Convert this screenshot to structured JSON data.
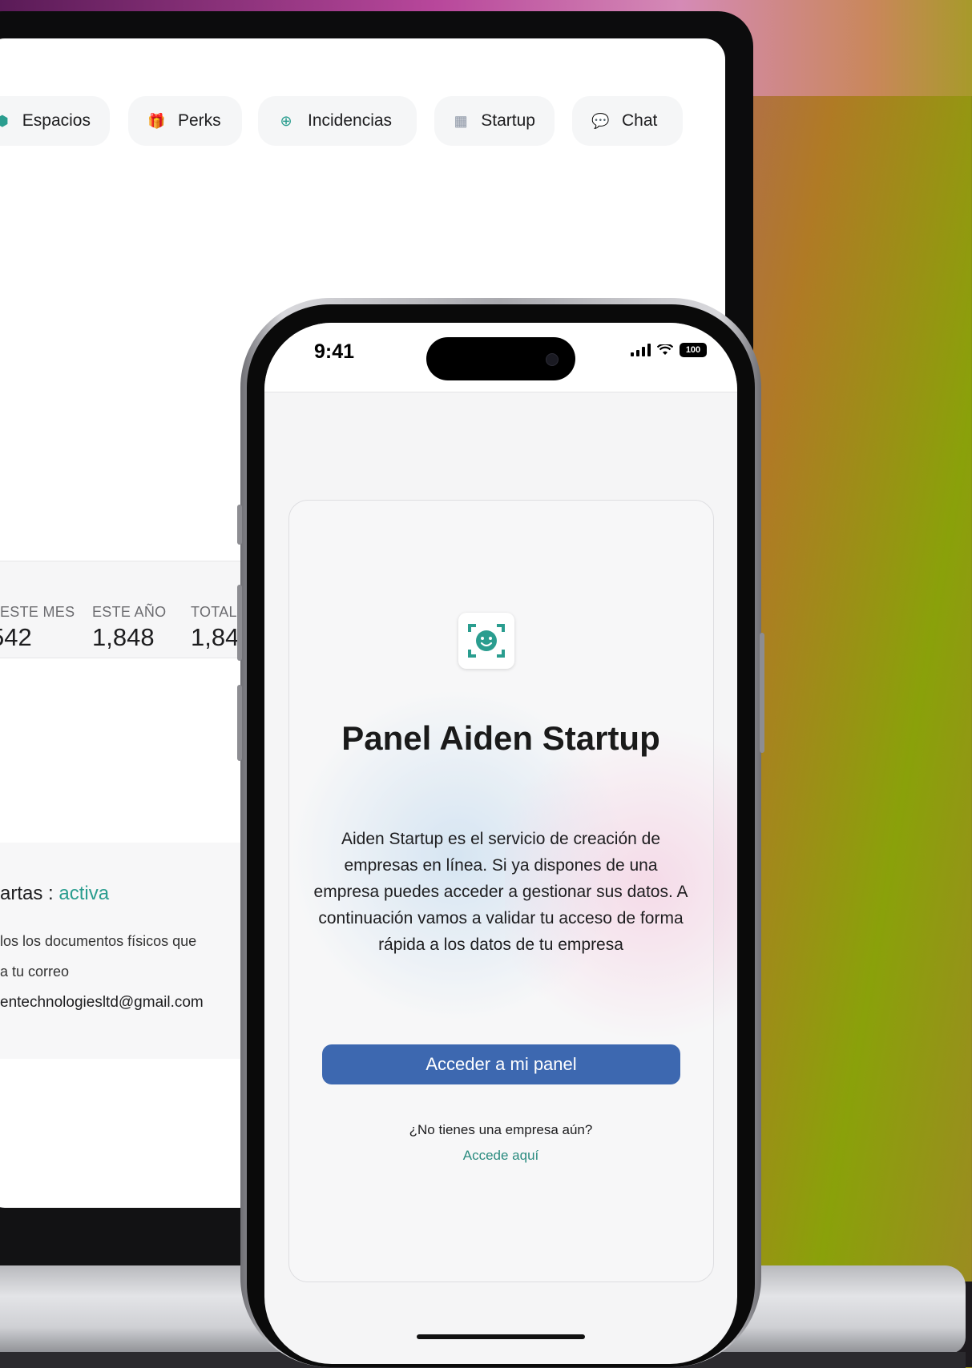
{
  "laptop": {
    "nav": [
      {
        "label": "Espacios",
        "icon": "cube-icon"
      },
      {
        "label": "Perks",
        "icon": "gift-icon"
      },
      {
        "label": "Incidencias",
        "icon": "plus-circle-icon"
      },
      {
        "label": "Startup",
        "icon": "building-icon"
      },
      {
        "label": "Chat",
        "icon": "chat-bubbles-icon"
      }
    ],
    "stats": [
      {
        "label": "ESTE MES",
        "value": "542"
      },
      {
        "label": "ESTE AÑO",
        "value": "1,848"
      },
      {
        "label": "TOTAL",
        "value": "1,84"
      }
    ],
    "mail": {
      "title_prefix": "artas : ",
      "status": "activa",
      "line1": "los los documentos físicos que",
      "line2": "a tu correo",
      "line3": "entechnologiesltd@gmail.com"
    }
  },
  "phone": {
    "status": {
      "time": "9:41",
      "battery": "100"
    },
    "title": "Panel Aiden Startup",
    "description": "Aiden Startup es el servicio de creación de empresas en línea. Si ya dispones de una empresa puedes acceder a gestionar sus datos. A continuación vamos a validar tu acceso de forma rápida a los datos de tu empresa",
    "cta": "Acceder a mi panel",
    "no_company": "¿No tienes una empresa aún?",
    "access_here": "Accede aquí"
  },
  "colors": {
    "accent": "#2a9d8f",
    "cta": "#3d68b0"
  }
}
